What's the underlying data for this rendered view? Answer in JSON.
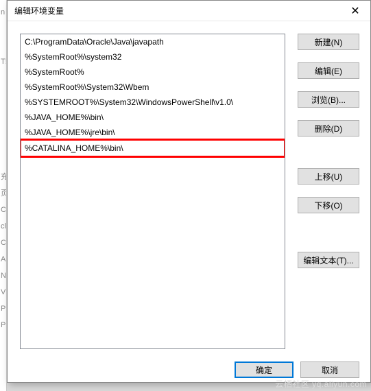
{
  "bg_labels": [
    "n",
    "",
    "",
    "T!",
    "",
    "",
    "",
    "",
    "",
    "",
    "充",
    "页",
    "C",
    "cl.",
    "C",
    "A",
    "N",
    "V",
    "P",
    "Pi"
  ],
  "dialog": {
    "title": "编辑环境变量",
    "close_glyph": "✕"
  },
  "list_items": [
    {
      "text": "C:\\ProgramData\\Oracle\\Java\\javapath",
      "highlight": false
    },
    {
      "text": "%SystemRoot%\\system32",
      "highlight": false
    },
    {
      "text": "%SystemRoot%",
      "highlight": false
    },
    {
      "text": "%SystemRoot%\\System32\\Wbem",
      "highlight": false
    },
    {
      "text": "%SYSTEMROOT%\\System32\\WindowsPowerShell\\v1.0\\",
      "highlight": false
    },
    {
      "text": "%JAVA_HOME%\\bin\\",
      "highlight": false
    },
    {
      "text": "%JAVA_HOME%\\jre\\bin\\",
      "highlight": false
    },
    {
      "text": "%CATALINA_HOME%\\bin\\",
      "highlight": true
    }
  ],
  "buttons": {
    "new": "新建(N)",
    "edit": "编辑(E)",
    "browse": "浏览(B)...",
    "delete": "删除(D)",
    "moveup": "上移(U)",
    "movedown": "下移(O)",
    "edittext": "编辑文本(T)...",
    "ok": "确定",
    "cancel": "取消"
  },
  "watermark": "云栖社区 yq.aliyun.com"
}
